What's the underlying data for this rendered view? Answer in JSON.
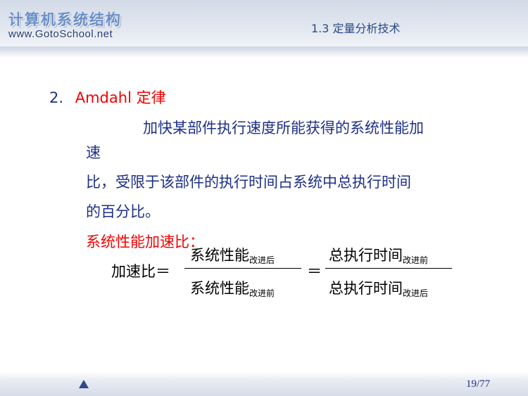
{
  "header": {
    "brand_title": "计算机系统结构",
    "brand_url": "www.GotoSchool.net",
    "section_title": "1.3  定量分析技术"
  },
  "heading": {
    "number": "2.",
    "title": "Amdahl 定律"
  },
  "body_lines": [
    "加快某部件执行速度所能获得的系统性能加",
    "速",
    "比，受限于该部件的执行时间占系统中总执行时间",
    "的百分比。"
  ],
  "formula": {
    "label": "系统性能加速比：",
    "lhs": "加速比＝",
    "equals": "＝",
    "frac1": {
      "num_main": "系统性能",
      "num_sub": "改进后",
      "den_main": "系统性能",
      "den_sub": "改进前"
    },
    "frac2": {
      "num_main": "总执行时间",
      "num_sub": "改进前",
      "den_main": "总执行时间",
      "den_sub": "改进后"
    }
  },
  "footer": {
    "page": "19/77",
    "nav_icon": "triangle-up-icon"
  }
}
